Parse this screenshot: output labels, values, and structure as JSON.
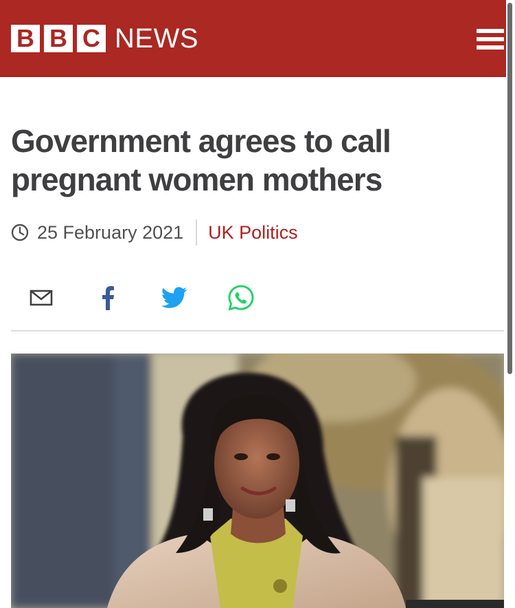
{
  "brand": {
    "blocks": [
      "B",
      "B",
      "C"
    ],
    "wordmark": "NEWS",
    "accent_color": "#ab2823",
    "menu_icon": "hamburger-menu-icon"
  },
  "article": {
    "headline": "Government agrees to call pregnant women mothers",
    "date": "25 February 2021",
    "category": "UK Politics",
    "category_color": "#b0201e",
    "clock_icon": "clock-icon"
  },
  "share": {
    "buttons": [
      {
        "icon": "email-icon"
      },
      {
        "icon": "facebook-icon",
        "color": "#3b5998"
      },
      {
        "icon": "twitter-icon",
        "color": "#1da1f2"
      },
      {
        "icon": "whatsapp-icon",
        "color": "#25d366"
      }
    ]
  },
  "image": {
    "subject": "woman-portrait-photo"
  }
}
